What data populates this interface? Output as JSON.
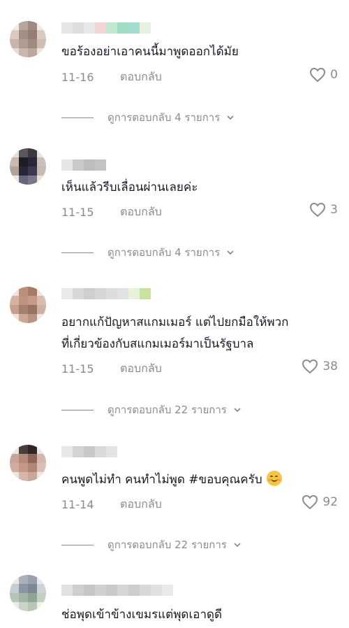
{
  "comments": [
    {
      "text_lines": [
        "ขอร้องอย่าเอาคนนี้มาพูดออกได้มัย"
      ],
      "date": "11-16",
      "reply_label": "ตอบกลับ",
      "likes": "0",
      "view_replies": "ดูการตอบกลับ 4 รายการ"
    },
    {
      "text_lines": [
        "เห็นแล้วรีบเลื่อนผ่านเลยค่ะ"
      ],
      "date": "11-15",
      "reply_label": "ตอบกลับ",
      "likes": "3",
      "view_replies": "ดูการตอบกลับ 4 รายการ"
    },
    {
      "text_lines": [
        "อยากแก้ปัญหาสแกมเมอร์ แต่ไปยกมือให้พวก",
        "ที่เกี่ยวข้องกับสแกมเมอร์มาเป็นรัฐบาล"
      ],
      "date": "11-15",
      "reply_label": "ตอบกลับ",
      "likes": "38",
      "view_replies": "ดูการตอบกลับ 22 รายการ"
    },
    {
      "text_lines": [
        "คนพูดไม่ทำ คนทำไม่พูด #ขอบคุณครับ"
      ],
      "date": "11-14",
      "reply_label": "ตอบกลับ",
      "likes": "92",
      "view_replies": "ดูการตอบกลับ 22 รายการ"
    },
    {
      "text_lines": [
        "ช่อพุดเข้าข้างเขมรแต่พุดเอาดูดี"
      ]
    }
  ],
  "icons": {
    "like": "heart-outline-icon",
    "expand": "chevron-down-icon",
    "emoji": "blush-smile-emoji-icon"
  },
  "colors": {
    "text_primary": "#161823",
    "text_secondary": "#8a8b91",
    "background": "#ffffff"
  }
}
